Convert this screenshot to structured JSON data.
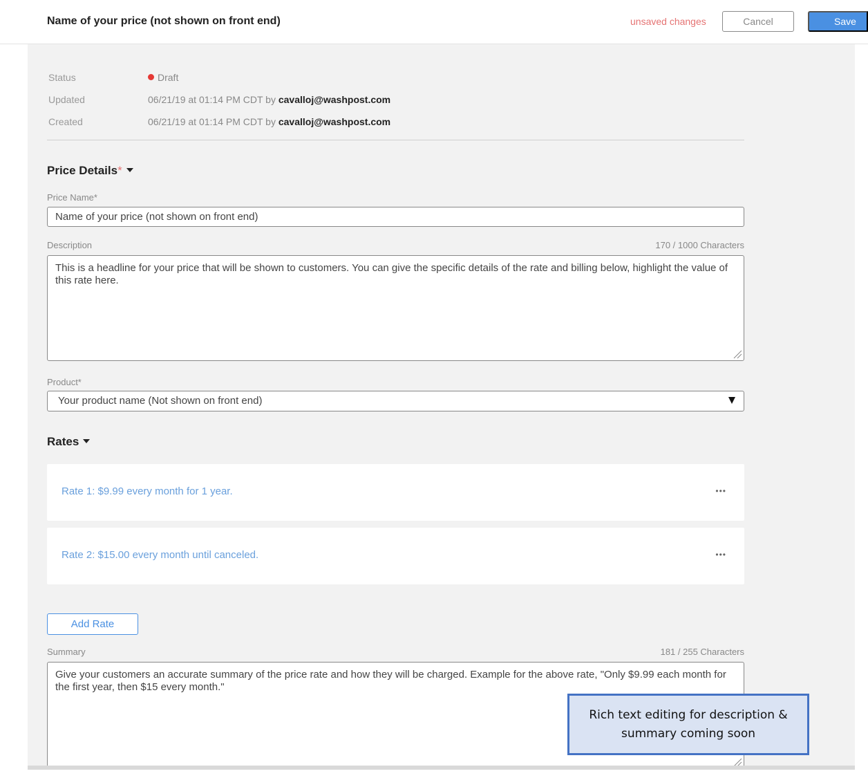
{
  "header": {
    "title": "Name of your price (not shown on front end)",
    "unsaved_text": "unsaved changes",
    "cancel_label": "Cancel",
    "save_label": "Save"
  },
  "meta": {
    "status_label": "Status",
    "status_value": "Draft",
    "updated_label": "Updated",
    "updated_value": "06/21/19 at 01:14 PM CDT by",
    "updated_user": "cavalloj@washpost.com",
    "created_label": "Created",
    "created_value": "06/21/19 at 01:14 PM CDT by",
    "created_user": "cavalloj@washpost.com"
  },
  "price_details": {
    "title": "Price Details",
    "required_mark": "*",
    "price_name_label": "Price Name*",
    "price_name_value": "Name of your price (not shown on front end)",
    "description_label": "Description",
    "description_count": "170 / 1000 Characters",
    "description_value": "This is a headline for your price that will be shown to customers. You can give the specific details of the rate and billing below, highlight the value of this rate here.",
    "product_label": "Product*",
    "product_value": "Your product name (Not shown on front end)"
  },
  "rates": {
    "title": "Rates",
    "items": [
      {
        "label": "Rate 1: $9.99 every month for 1 year.",
        "menu": "•••"
      },
      {
        "label": "Rate 2: $15.00 every month until canceled.",
        "menu": "•••"
      }
    ],
    "add_label": "Add Rate"
  },
  "summary": {
    "label": "Summary",
    "count": "181 / 255 Characters",
    "value": "Give your customers an accurate summary of the price rate and how they will be charged. Example for the above rate, \"Only $9.99 each month for the first year, then $15 every month.\""
  },
  "callout": {
    "text": "Rich text editing for description & summary coming soon"
  },
  "colors": {
    "accent": "#4a90e2",
    "unsaved": "#e57373",
    "status_dot": "#e53935",
    "rate_link": "#6aa0dc",
    "callout_bg": "#dae3f3",
    "callout_border": "#4472c4"
  }
}
